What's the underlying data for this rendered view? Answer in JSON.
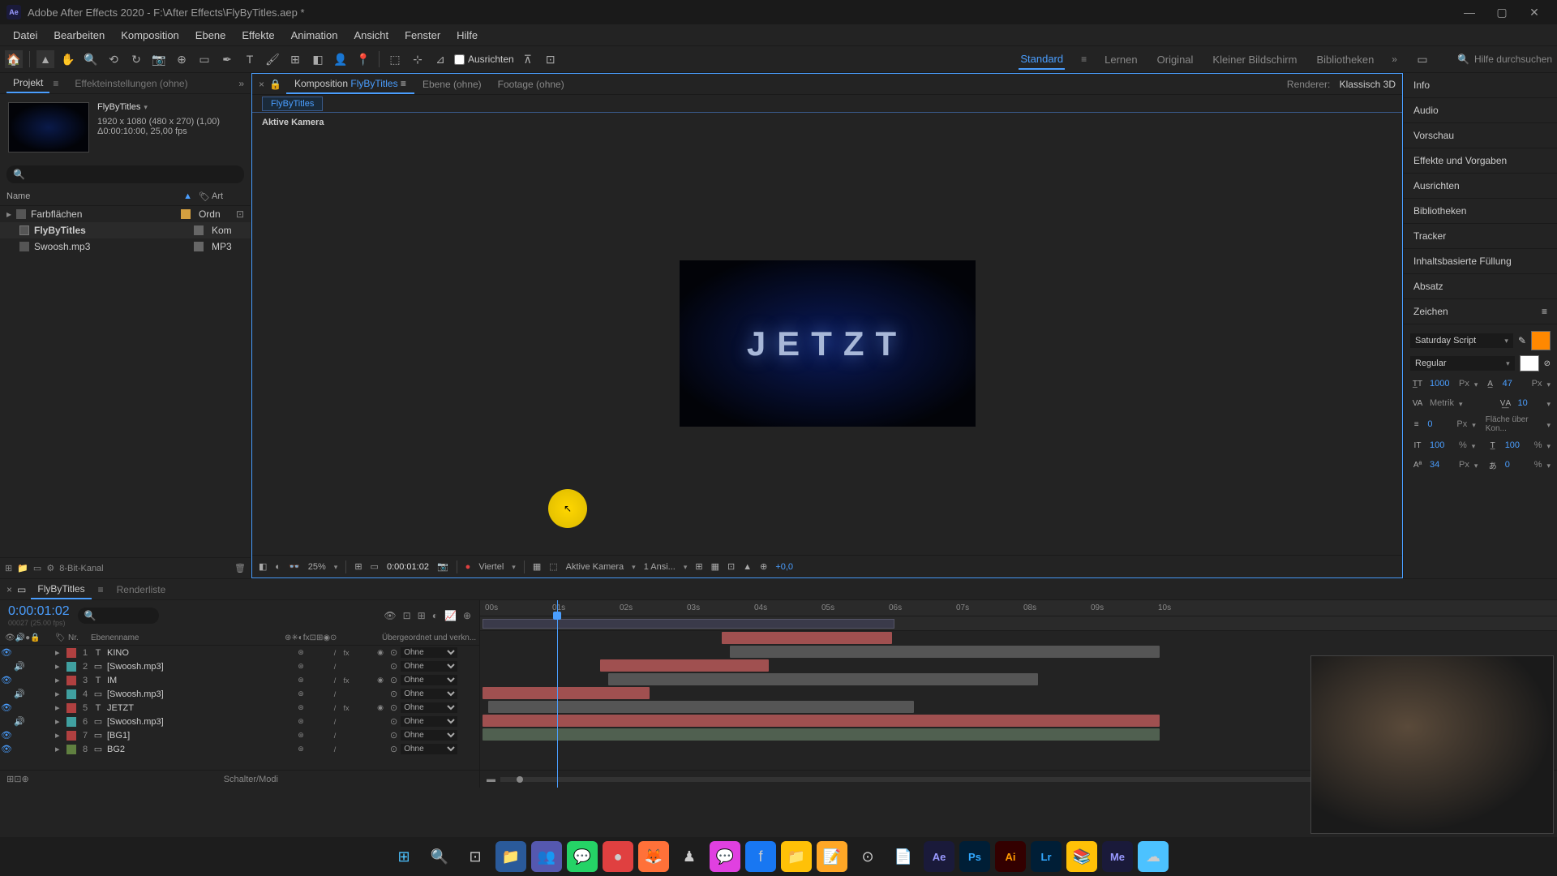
{
  "titlebar": {
    "title": "Adobe After Effects 2020 - F:\\After Effects\\FlyByTitles.aep *"
  },
  "menubar": [
    "Datei",
    "Bearbeiten",
    "Komposition",
    "Ebene",
    "Effekte",
    "Animation",
    "Ansicht",
    "Fenster",
    "Hilfe"
  ],
  "toolbar": {
    "ausrichten": "Ausrichten",
    "workspaces": [
      "Standard",
      "Lernen",
      "Original",
      "Kleiner Bildschirm",
      "Bibliotheken"
    ],
    "active_workspace": 0,
    "search_placeholder": "Hilfe durchsuchen"
  },
  "project_panel": {
    "tabs": [
      "Projekt",
      "Effekteinstellungen (ohne)"
    ],
    "comp_name": "FlyByTitles",
    "comp_info1": "1920 x 1080 (480 x 270) (1,00)",
    "comp_info2": "Δ0:00:10:00, 25,00 fps",
    "header_name": "Name",
    "header_type": "Art",
    "items": [
      {
        "name": "Farbflächen",
        "type": "Ordn",
        "icon": "folder"
      },
      {
        "name": "FlyByTitles",
        "type": "Kom",
        "icon": "comp"
      },
      {
        "name": "Swoosh.mp3",
        "type": "MP3",
        "icon": "audio"
      }
    ],
    "footer": "8-Bit-Kanal"
  },
  "comp_panel": {
    "tabs": [
      {
        "label": "Komposition",
        "link": "FlyByTitles"
      },
      {
        "label": "Ebene (ohne)"
      },
      {
        "label": "Footage (ohne)"
      }
    ],
    "renderer_label": "Renderer:",
    "renderer": "Klassisch 3D",
    "breadcrumb": "FlyByTitles",
    "camera": "Aktive Kamera",
    "display_text": "JETZT",
    "footer": {
      "zoom": "25%",
      "time": "0:00:01:02",
      "res": "Viertel",
      "cam": "Aktive Kamera",
      "views": "1 Ansi...",
      "exp": "+0,0"
    }
  },
  "right_panels": {
    "items": [
      "Info",
      "Audio",
      "Vorschau",
      "Effekte und Vorgaben",
      "Ausrichten",
      "Bibliotheken",
      "Tracker",
      "Inhaltsbasierte Füllung",
      "Absatz"
    ],
    "char_title": "Zeichen",
    "char": {
      "font": "Saturday Script",
      "style": "Regular",
      "size": "1000",
      "size_unit": "Px",
      "leading": "47",
      "kerning": "Metrik",
      "tracking": "10",
      "stroke": "0",
      "stroke_unit": "Px",
      "stroke_opt": "Fläche über Kon...",
      "vscale": "100",
      "hscale": "100",
      "baseline": "34",
      "baseline_unit": "Px",
      "tsume": "0"
    }
  },
  "timeline": {
    "tab": "FlyByTitles",
    "renderlist": "Renderliste",
    "time": "0:00:01:02",
    "time_sub": "00027 (25.00 fps)",
    "header": {
      "num": "Nr.",
      "layer": "Ebenenname",
      "parent": "Übergeordnet und verkn..."
    },
    "footer": "Schalter/Modi",
    "parent_none": "Ohne",
    "ruler": [
      "00s",
      "01s",
      "02s",
      "03s",
      "04s",
      "05s",
      "06s",
      "07s",
      "08s",
      "09s",
      "10s"
    ],
    "layers": [
      {
        "num": 1,
        "name": "KINO",
        "label": "red",
        "type": "T",
        "vis": true,
        "aud": false,
        "threed": true
      },
      {
        "num": 2,
        "name": "[Swoosh.mp3]",
        "label": "cyan",
        "type": "",
        "vis": false,
        "aud": true,
        "threed": false
      },
      {
        "num": 3,
        "name": "IM",
        "label": "red",
        "type": "T",
        "vis": true,
        "aud": false,
        "threed": true
      },
      {
        "num": 4,
        "name": "[Swoosh.mp3]",
        "label": "cyan",
        "type": "",
        "vis": false,
        "aud": true,
        "threed": false
      },
      {
        "num": 5,
        "name": "JETZT",
        "label": "red",
        "type": "T",
        "vis": true,
        "aud": false,
        "threed": true
      },
      {
        "num": 6,
        "name": "[Swoosh.mp3]",
        "label": "cyan",
        "type": "",
        "vis": false,
        "aud": true,
        "threed": false
      },
      {
        "num": 7,
        "name": "[BG1]",
        "label": "red",
        "type": "",
        "vis": true,
        "aud": false,
        "threed": false
      },
      {
        "num": 8,
        "name": "BG2",
        "label": "green",
        "type": "",
        "vis": true,
        "aud": false,
        "threed": false
      }
    ]
  }
}
